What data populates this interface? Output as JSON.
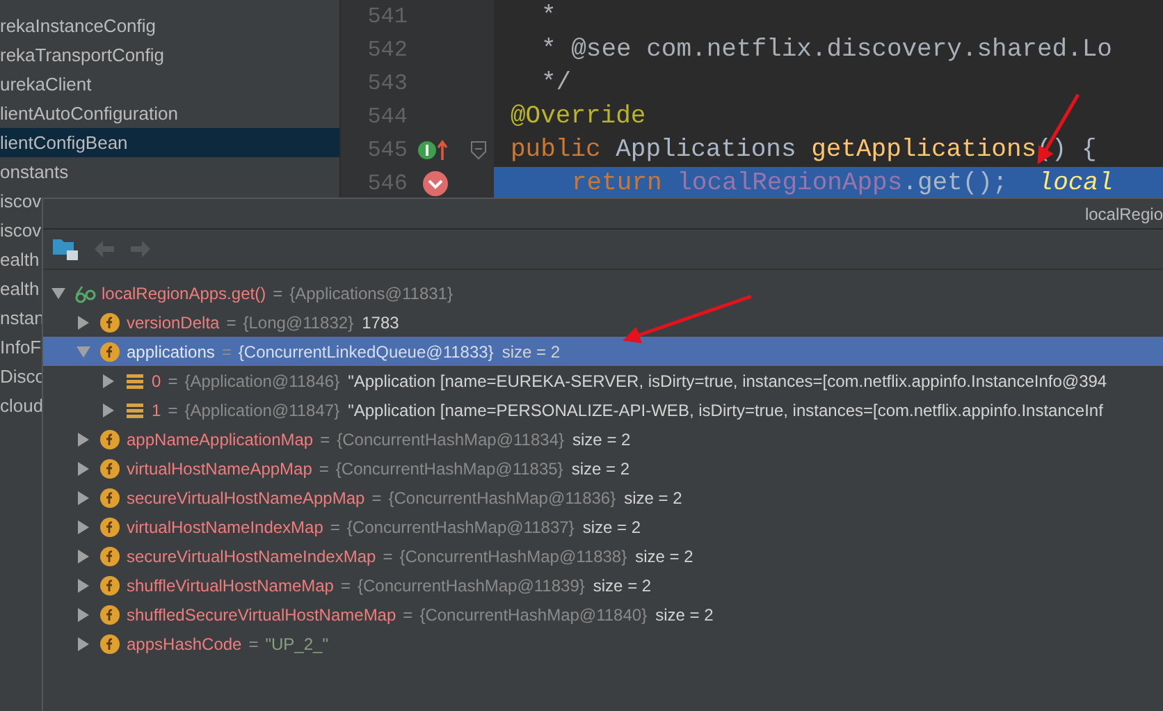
{
  "project_tree": {
    "items": [
      {
        "label": "rekaInstanceConfig",
        "selected": false
      },
      {
        "label": "rekaTransportConfig",
        "selected": false
      },
      {
        "label": "urekaClient",
        "selected": false
      },
      {
        "label": "lientAutoConfiguration",
        "selected": false
      },
      {
        "label": "lientConfigBean",
        "selected": true
      },
      {
        "label": "onstants",
        "selected": false
      },
      {
        "label": "iscov",
        "selected": false
      },
      {
        "label": "iscov",
        "selected": false
      },
      {
        "label": "ealth",
        "selected": false
      },
      {
        "label": "ealth",
        "selected": false
      },
      {
        "label": "nstan",
        "selected": false
      },
      {
        "label": "InfoF",
        "selected": false
      },
      {
        "label": "Disco",
        "selected": false
      },
      {
        "label": "cloud",
        "selected": false
      }
    ]
  },
  "editor": {
    "lines": [
      {
        "number": "541",
        "current": false,
        "breakpoint": false,
        "overrides": false,
        "fold": false,
        "kind": "javadoc",
        "tokens": [
          {
            "kind": "comment",
            "text": "*"
          }
        ]
      },
      {
        "number": "542",
        "current": false,
        "breakpoint": false,
        "overrides": false,
        "fold": false,
        "kind": "javadoc",
        "tokens": [
          {
            "kind": "comment",
            "text": "* @see com.netflix.discovery.shared.Lo"
          }
        ]
      },
      {
        "number": "543",
        "current": false,
        "breakpoint": false,
        "overrides": false,
        "fold": false,
        "kind": "javadoc",
        "tokens": [
          {
            "kind": "comment",
            "text": "*/"
          }
        ]
      },
      {
        "number": "544",
        "current": false,
        "breakpoint": false,
        "overrides": false,
        "fold": false,
        "kind": "declaration",
        "tokens": [
          {
            "kind": "annotation",
            "text": "@Override"
          }
        ]
      },
      {
        "number": "545",
        "current": false,
        "breakpoint": false,
        "overrides": true,
        "fold": true,
        "kind": "declaration",
        "tokens": [
          {
            "kind": "keyword",
            "text": "public "
          },
          {
            "kind": "plain",
            "text": "Applications "
          },
          {
            "kind": "method",
            "text": "getApplications"
          },
          {
            "kind": "plain",
            "text": "() {"
          }
        ]
      },
      {
        "number": "546",
        "current": true,
        "breakpoint": true,
        "overrides": false,
        "fold": false,
        "kind": "statement",
        "tokens": [
          {
            "kind": "keyword",
            "text": "return "
          },
          {
            "kind": "field",
            "text": "localRegionApps"
          },
          {
            "kind": "plain",
            "text": ".get();"
          },
          {
            "kind": "inline_value",
            "text": "local"
          }
        ]
      }
    ]
  },
  "debug_popup": {
    "title": "localRegio",
    "tree": [
      {
        "kind": "watch",
        "name": "localRegionApps.get()",
        "separator": "=",
        "type": "{Applications@11831}",
        "expanded": true,
        "selected": false,
        "children": [
          {
            "kind": "field",
            "name": "versionDelta",
            "separator": "=",
            "type": "{Long@11832}",
            "value": "1783",
            "expanded": false,
            "selected": false
          },
          {
            "kind": "field",
            "name": "applications",
            "separator": "=",
            "type": "{ConcurrentLinkedQueue@11833}",
            "value": "size = 2",
            "expanded": true,
            "selected": true,
            "children": [
              {
                "kind": "element",
                "name": "0",
                "separator": "=",
                "type": "{Application@11846}",
                "value": "\"Application [name=EUREKA-SERVER, isDirty=true, instances=[com.netflix.appinfo.InstanceInfo@394",
                "expanded": false,
                "selected": false
              },
              {
                "kind": "element",
                "name": "1",
                "separator": "=",
                "type": "{Application@11847}",
                "value": "\"Application [name=PERSONALIZE-API-WEB, isDirty=true, instances=[com.netflix.appinfo.InstanceInf",
                "expanded": false,
                "selected": false
              }
            ]
          },
          {
            "kind": "field",
            "name": "appNameApplicationMap",
            "separator": "=",
            "type": "{ConcurrentHashMap@11834}",
            "value": "size = 2",
            "expanded": false,
            "selected": false
          },
          {
            "kind": "field",
            "name": "virtualHostNameAppMap",
            "separator": "=",
            "type": "{ConcurrentHashMap@11835}",
            "value": "size = 2",
            "expanded": false,
            "selected": false
          },
          {
            "kind": "field",
            "name": "secureVirtualHostNameAppMap",
            "separator": "=",
            "type": "{ConcurrentHashMap@11836}",
            "value": "size = 2",
            "expanded": false,
            "selected": false
          },
          {
            "kind": "field",
            "name": "virtualHostNameIndexMap",
            "separator": "=",
            "type": "{ConcurrentHashMap@11837}",
            "value": "size = 2",
            "expanded": false,
            "selected": false
          },
          {
            "kind": "field",
            "name": "secureVirtualHostNameIndexMap",
            "separator": "=",
            "type": "{ConcurrentHashMap@11838}",
            "value": "size = 2",
            "expanded": false,
            "selected": false
          },
          {
            "kind": "field",
            "name": "shuffleVirtualHostNameMap",
            "separator": "=",
            "type": "{ConcurrentHashMap@11839}",
            "value": "size = 2",
            "expanded": false,
            "selected": false
          },
          {
            "kind": "field",
            "name": "shuffledSecureVirtualHostNameMap",
            "separator": "=",
            "type": "{ConcurrentHashMap@11840}",
            "value": "size = 2",
            "expanded": false,
            "selected": false
          },
          {
            "kind": "field",
            "name": "appsHashCode",
            "separator": "=",
            "value": "\"UP_2_\"",
            "expanded": false,
            "selected": false
          }
        ]
      }
    ]
  }
}
